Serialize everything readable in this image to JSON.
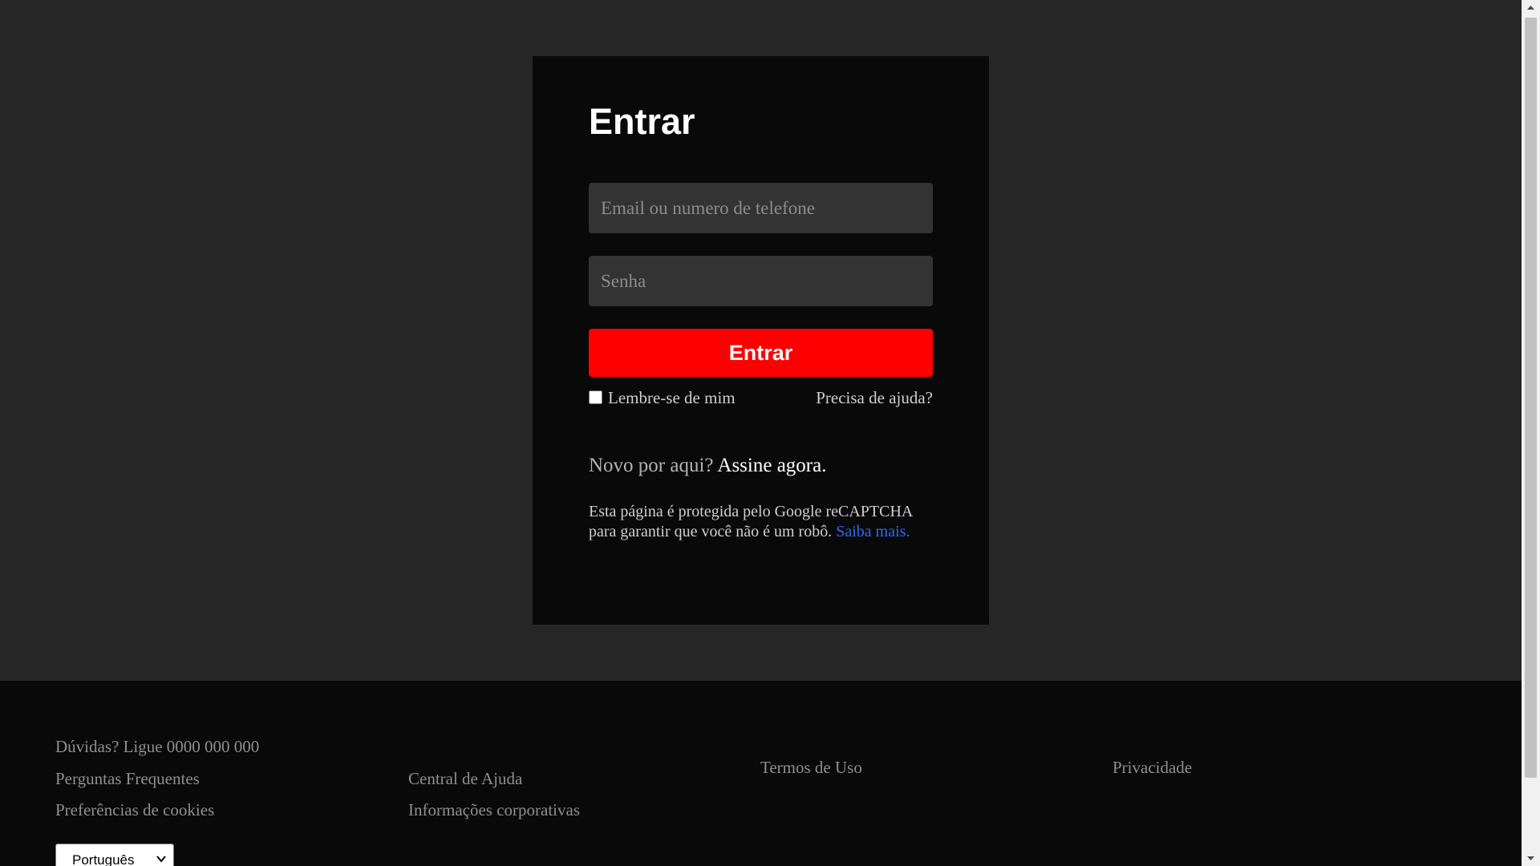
{
  "login": {
    "title": "Entrar",
    "email_placeholder": "Email ou numero de telefone",
    "password_placeholder": "Senha",
    "submit_label": "Entrar",
    "remember_label": "Lembre-se de mim",
    "remember_checked": false,
    "help_label": "Precisa de ajuda?",
    "signup_prefix": "Novo por aqui? ",
    "signup_link": "Assine agora.",
    "recaptcha_text": "Esta página é protegida pelo Google reCAPTCHA para garantir que você não é um robô. ",
    "learn_more": "Saiba mais."
  },
  "footer": {
    "phone": "Dúvidas? Ligue 0000 000 000",
    "faq": "Perguntas Frequentes",
    "cookies": "Preferências de cookies",
    "help_center": "Central de Ajuda",
    "corporate": "Informações corporativas",
    "terms": "Termos de Uso",
    "privacy": "Privacidade",
    "language": "Português"
  },
  "colors": {
    "page_background": "#262627",
    "card_background": "#090909",
    "accent_red": "#ff0000",
    "link_blue": "#2d6bf5"
  },
  "icons": {
    "language_select": "chevron-down-icon",
    "scroll_up": "triangle-up-icon",
    "scroll_down": "triangle-down-icon"
  }
}
